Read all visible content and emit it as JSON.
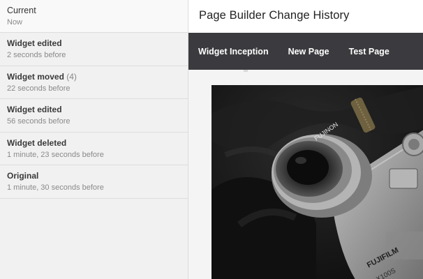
{
  "history": {
    "items": [
      {
        "title": "Current",
        "count": "",
        "time": "Now",
        "current": true
      },
      {
        "title": "Widget edited",
        "count": "",
        "time": "2 seconds before"
      },
      {
        "title": "Widget moved",
        "count": "(4)",
        "time": "22 seconds before"
      },
      {
        "title": "Widget edited",
        "count": "",
        "time": "56 seconds before"
      },
      {
        "title": "Widget deleted",
        "count": "",
        "time": "1 minute, 23 seconds before"
      },
      {
        "title": "Original",
        "count": "",
        "time": "1 minute, 30 seconds before"
      }
    ]
  },
  "preview": {
    "title": "Page Builder Change History",
    "nav": [
      "Widget Inception",
      "New Page",
      "Test Page"
    ],
    "image": {
      "lens_text": "FUJINON",
      "brand_text": "FUJIFILM",
      "model_text": "X100S"
    }
  },
  "colors": {
    "sidebar_bg": "#f1f1f1",
    "nav_bg": "#3b3b3f",
    "nav_text": "#ffffff",
    "photo_bg": "#161616"
  }
}
